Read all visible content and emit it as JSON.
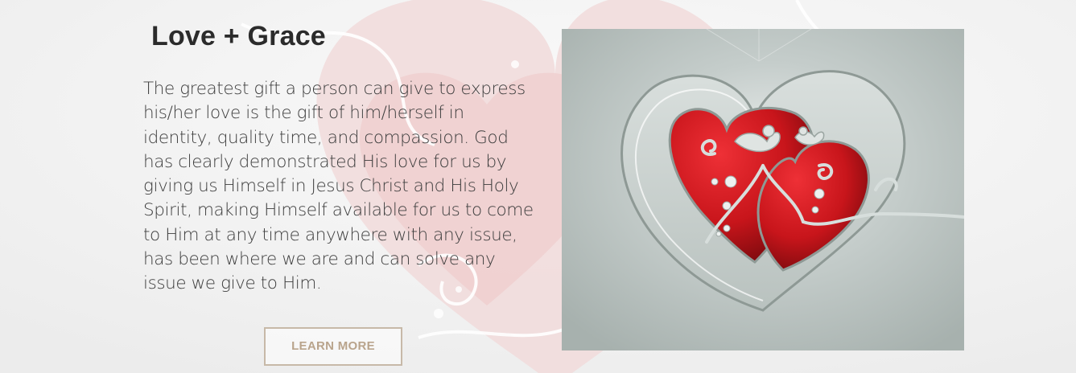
{
  "section": {
    "title": "Love + Grace",
    "body": "The greatest gift a person can give to express his/her love is the gift of him/herself in identity, quality time, and compassion. God has clearly demonstrated His love for us by giving us Himself in Jesus Christ and His Holy Spirit, making Himself available for us to come to Him at any time anywhere with any issue, has been where we are and can solve any issue we give to Him.",
    "button_label": "LEARN MORE"
  },
  "image": {
    "subject": "red-hearts-with-birds-illustration"
  },
  "colors": {
    "background": "#f3f3f3",
    "heading": "#2b2b2b",
    "body_text": "#3d3d3d",
    "button_border": "#c7b9a8",
    "button_text": "#b9a48c",
    "heart_red": "#c8151b",
    "image_bg": "#a9b4b1"
  }
}
